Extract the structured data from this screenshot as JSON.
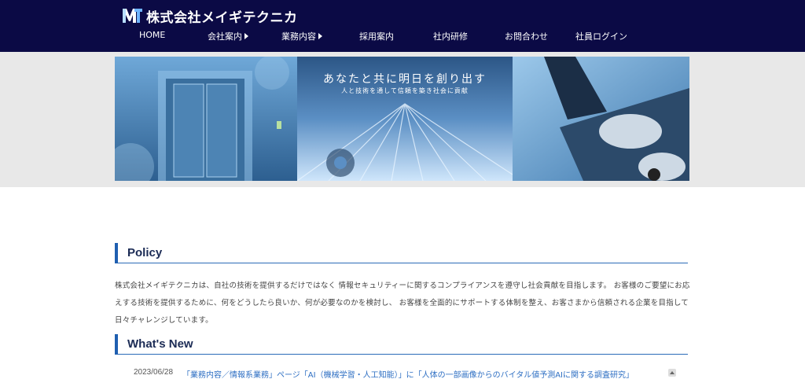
{
  "header": {
    "company_name": "株式会社メイギテクニカ",
    "logo_icon": "mt-logo-icon",
    "nav": [
      {
        "label": "HOME",
        "has_submenu": false
      },
      {
        "label": "会社案内",
        "has_submenu": true
      },
      {
        "label": "業務内容",
        "has_submenu": true
      },
      {
        "label": "採用案内",
        "has_submenu": false
      },
      {
        "label": "社内研修",
        "has_submenu": false
      },
      {
        "label": "お問合わせ",
        "has_submenu": false
      },
      {
        "label": "社員ログイン",
        "has_submenu": false
      }
    ]
  },
  "hero": {
    "title": "あなたと共に明日を創り出す",
    "subtitle": "人と技術を通して信頼を築き社会に貢献"
  },
  "policy": {
    "heading": "Policy",
    "body": "株式会社メイギテクニカは、自社の技術を提供するだけではなく 情報セキュリティーに関するコンプライアンスを遵守し社会貢献を目指します。 お客様のご要望にお応えする技術を提供するために、何をどうしたら良いか、何が必要なのかを検討し、 お客様を全面的にサポートする体制を整え、お客さまから信頼される企業を目指して日々チャレンジしています。"
  },
  "whats_new": {
    "heading": "What's New",
    "items": [
      {
        "date": "2023/06/28",
        "text": "「業務内容／情報系業務」ページ「AI（機械学習・人工知能）」に「人体の一部画像からのバイタル値予測AIに関する調査研究」"
      }
    ]
  },
  "colors": {
    "header_bg": "#0b0a45",
    "accent": "#1f5fb0",
    "link": "#2e6fc3"
  }
}
